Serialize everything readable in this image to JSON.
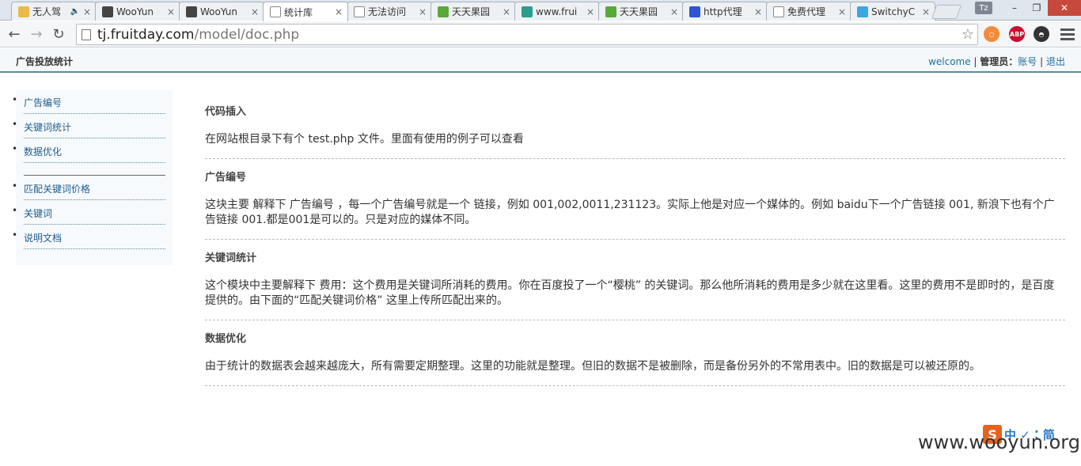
{
  "browser": {
    "tabs": [
      {
        "title": "无人驾",
        "icon": "notebook-icon",
        "color": "#e9b949",
        "speaker": "🔈"
      },
      {
        "title": "WooYun",
        "icon": "wooyun-icon",
        "color": "#444444"
      },
      {
        "title": "WooYun",
        "icon": "wooyun-icon",
        "color": "#444444"
      },
      {
        "title": "统计库",
        "icon": "page-icon",
        "color": "#ffffff",
        "active": true
      },
      {
        "title": "无法访问",
        "icon": "page-icon",
        "color": "#ffffff"
      },
      {
        "title": "天天果园",
        "icon": "fruitday-icon",
        "color": "#5aa83a"
      },
      {
        "title": "www.frui",
        "icon": "globe-icon",
        "color": "#2c9e8c"
      },
      {
        "title": "天天果园",
        "icon": "fruitday-icon",
        "color": "#5aa83a"
      },
      {
        "title": "http代理",
        "icon": "baidu-icon",
        "color": "#2f55d4"
      },
      {
        "title": "免费代理",
        "icon": "page-icon",
        "color": "#ffffff"
      },
      {
        "title": "SwitchyC",
        "icon": "switchy-icon",
        "color": "#3aa8e0"
      }
    ],
    "profile_badge": "Tz",
    "window_controls": {
      "minimize": "–",
      "maximize": "❐",
      "close": "✕"
    },
    "url_host": "tj.fruitday.com",
    "url_path": "/model/doc.php",
    "extensions": [
      {
        "name": "ring-extension-icon",
        "color": "#f28b3c",
        "label": "○"
      },
      {
        "name": "adblock-icon",
        "color": "#c8102e",
        "label": "ABP"
      },
      {
        "name": "mask-extension-icon",
        "color": "#333333",
        "label": "◓"
      }
    ]
  },
  "header": {
    "site_title": "广告投放统计",
    "welcome": "welcome",
    "sep1": " | ",
    "role_label": "管理员：",
    "account_link": "账号",
    "sep2": " | ",
    "logout_link": "退出"
  },
  "sidebar": {
    "group1": [
      "广告编号",
      "关键词统计",
      "数据优化"
    ],
    "group2": [
      "匹配关键词价格",
      "关键词",
      "说明文档"
    ]
  },
  "sections": [
    {
      "title": "代码插入",
      "body": "在网站根目录下有个 test.php 文件。里面有使用的例子可以查看"
    },
    {
      "title": "广告编号",
      "body": "这块主要 解释下 广告编号 ，每一个广告编号就是一个 链接，例如 001,002,0011,231123。实际上他是对应一个媒体的。例如 baidu下一个广告链接 001, 新浪下也有个广告链接 001.都是001是可以的。只是对应的媒体不同。"
    },
    {
      "title": "关键词统计",
      "body": "这个模块中主要解释下 费用：这个费用是关键词所消耗的费用。你在百度投了一个“樱桃” 的关键词。那么他所消耗的费用是多少就在这里看。这里的费用不是即时的，是百度提供的。由下面的“匹配关键词价格” 这里上传所匹配出来的。"
    },
    {
      "title": "数据优化",
      "body": "由于统计的数据表会越来越庞大，所有需要定期整理。这里的功能就是整理。但旧的数据不是被删除，而是备份另外的不常用表中。旧的数据是可以被还原的。"
    }
  ],
  "overlay": {
    "ime_logo": "S",
    "ime_text": "中 ✓ ⁚ 简",
    "watermark": "www.wooyun.org"
  }
}
